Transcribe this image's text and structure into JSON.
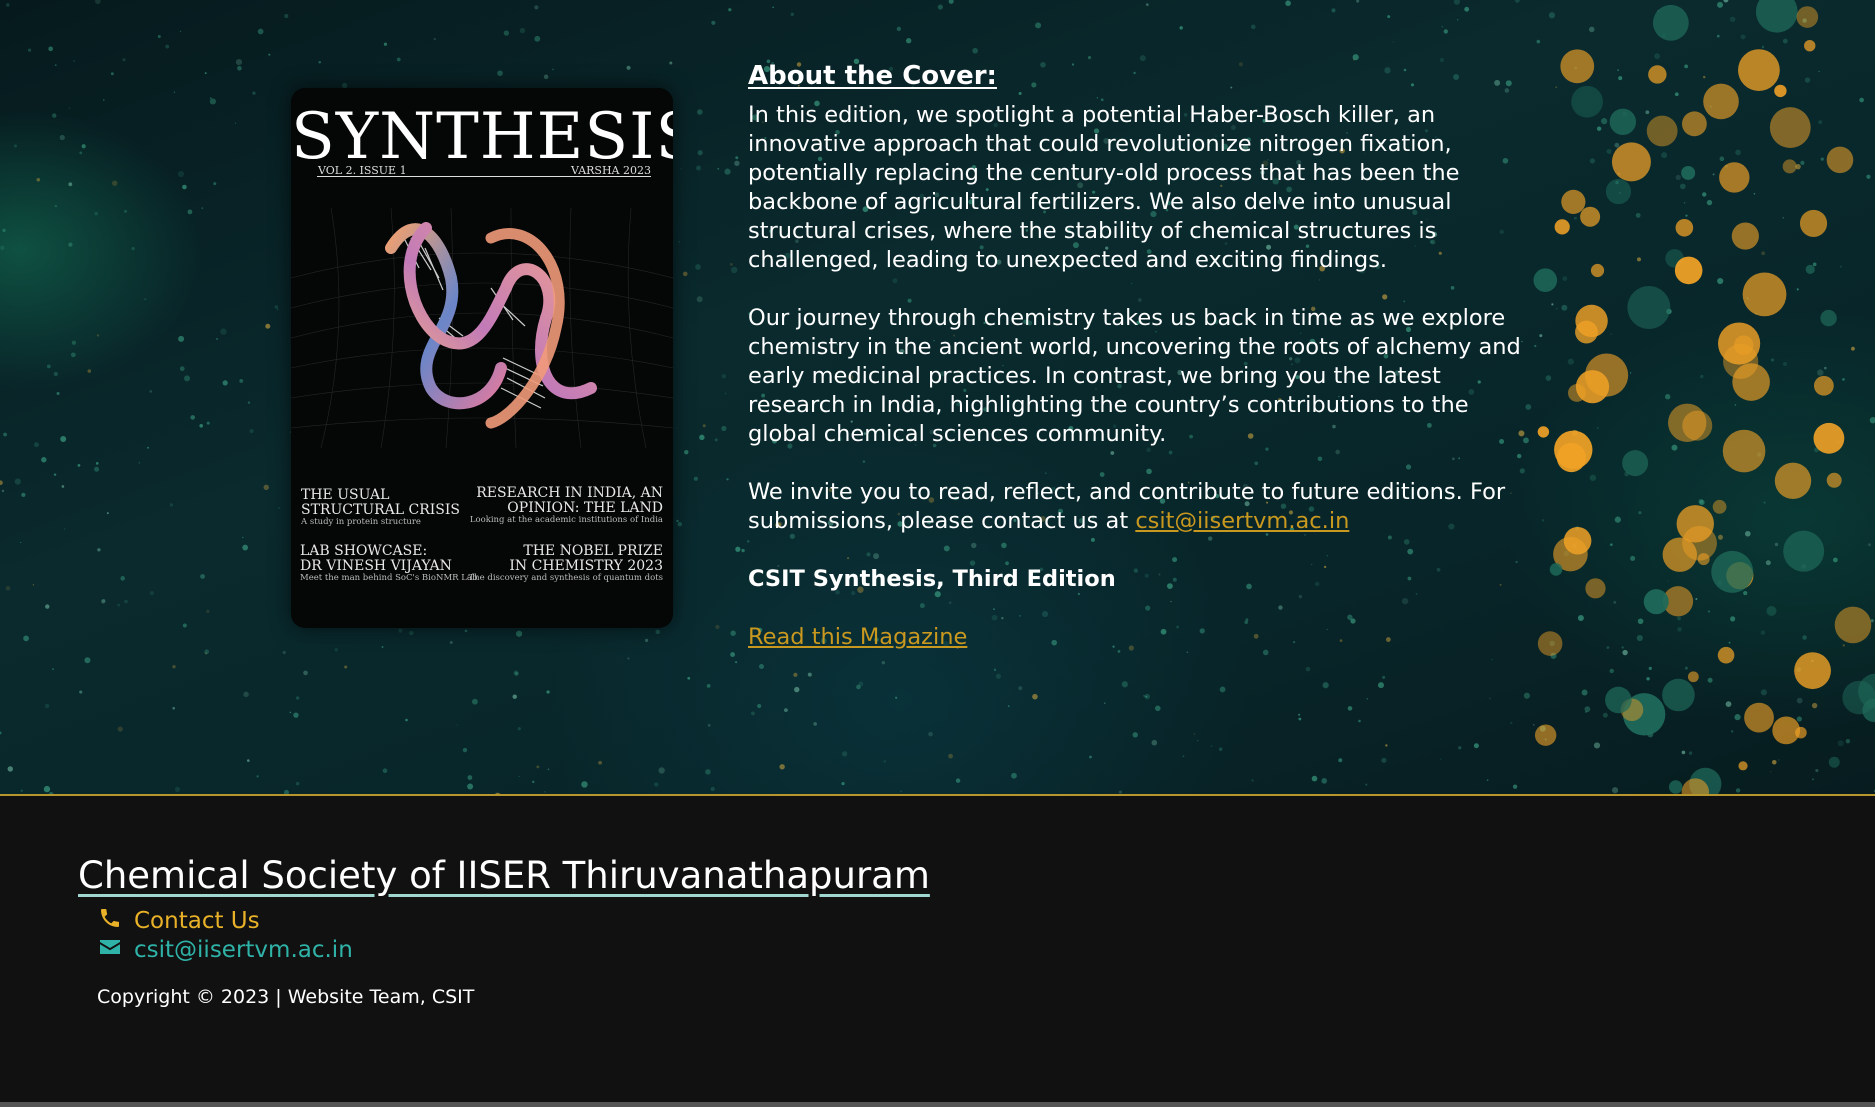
{
  "cover": {
    "title": "SYNTHESIS",
    "volume": "VOL 2. ISSUE 1",
    "edition_name": "VARSHA 2023",
    "sections": [
      {
        "title1": "THE USUAL",
        "title2": "STRUCTURAL CRISIS",
        "sub": "A study in protein structure"
      },
      {
        "title1": "RESEARCH IN INDIA, AN",
        "title2": "OPINION: THE LAND",
        "sub": "Looking at the academic institutions of India"
      },
      {
        "title1": "LAB SHOWCASE:",
        "title2": "DR VINESH VIJAYAN",
        "sub": "Meet the man behind SoC's BioNMR Lab"
      },
      {
        "title1": "THE NOBEL PRIZE",
        "title2": "IN CHEMISTRY 2023",
        "sub": "The discovery and synthesis of quantum dots"
      }
    ]
  },
  "about": {
    "heading": "About the Cover:",
    "para1": "In this edition, we spotlight a potential Haber-Bosch killer, an innovative approach that could revolutionize nitrogen fixation, potentially replacing the century-old process that has been the backbone of agricultural fertilizers. We also delve into unusual structural crises, where the stability of chemical structures is challenged, leading to unexpected and exciting findings.",
    "para2": "Our journey through chemistry takes us back in time as we explore chemistry in the ancient world, uncovering the roots of alchemy and early medicinal practices. In contrast, we bring you the latest research in India, highlighting the country’s contributions to the global chemical sciences community.",
    "para3_prefix": "We invite you to read, reflect, and contribute to future editions. For submissions, please contact us at ",
    "email_link": "csit@iisertvm.ac.in",
    "edition": "CSIT Synthesis, Third Edition",
    "read_link": "Read this Magazine"
  },
  "footer": {
    "org_name": "Chemical Society of IISER Thiruvanathapuram",
    "contact_label": "Contact Us",
    "email": "csit@iisertvm.ac.in",
    "copyright": "Copyright © 2023 | Website Team, CSIT"
  },
  "colors": {
    "accent_gold": "#c9981f",
    "contact_yellow": "#e8b128",
    "email_teal": "#2fb3a8"
  },
  "icons": {
    "contact": "phone-icon",
    "email": "envelope-icon"
  }
}
